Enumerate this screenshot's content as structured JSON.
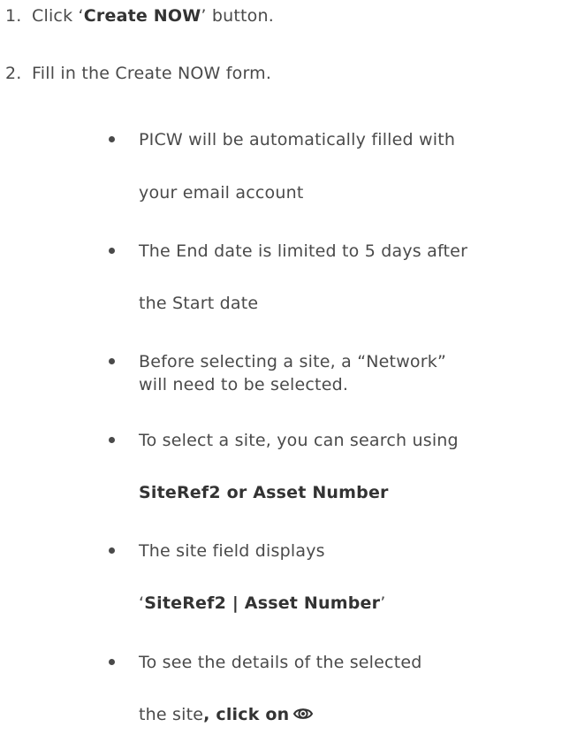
{
  "steps": [
    {
      "number": "1.",
      "prefix": "Click ‘",
      "bold": "Create NOW",
      "suffix": "’ button."
    },
    {
      "number": "2.",
      "text": "Fill in the Create NOW form."
    }
  ],
  "bullets": [
    {
      "line1": "PICW will be automatically filled with",
      "line2": "your email account"
    },
    {
      "line1": "The End date is limited to 5 days after",
      "line2": "the Start date"
    },
    {
      "line1": "Before selecting a site, a “Network”",
      "line2": "will need to be selected."
    },
    {
      "line1": "To select a site, you can search using",
      "line2_bold": "SiteRef2 or Asset Number"
    },
    {
      "line1": "The site field displays",
      "line2_prefix": "‘",
      "line2_bold": "SiteRef2 | Asset Number",
      "line2_suffix": "’"
    },
    {
      "line1": "To see the details of the selected",
      "line2_prefix": "the site",
      "line2_bold": ", click on",
      "line2_icon": "eye-icon"
    }
  ]
}
